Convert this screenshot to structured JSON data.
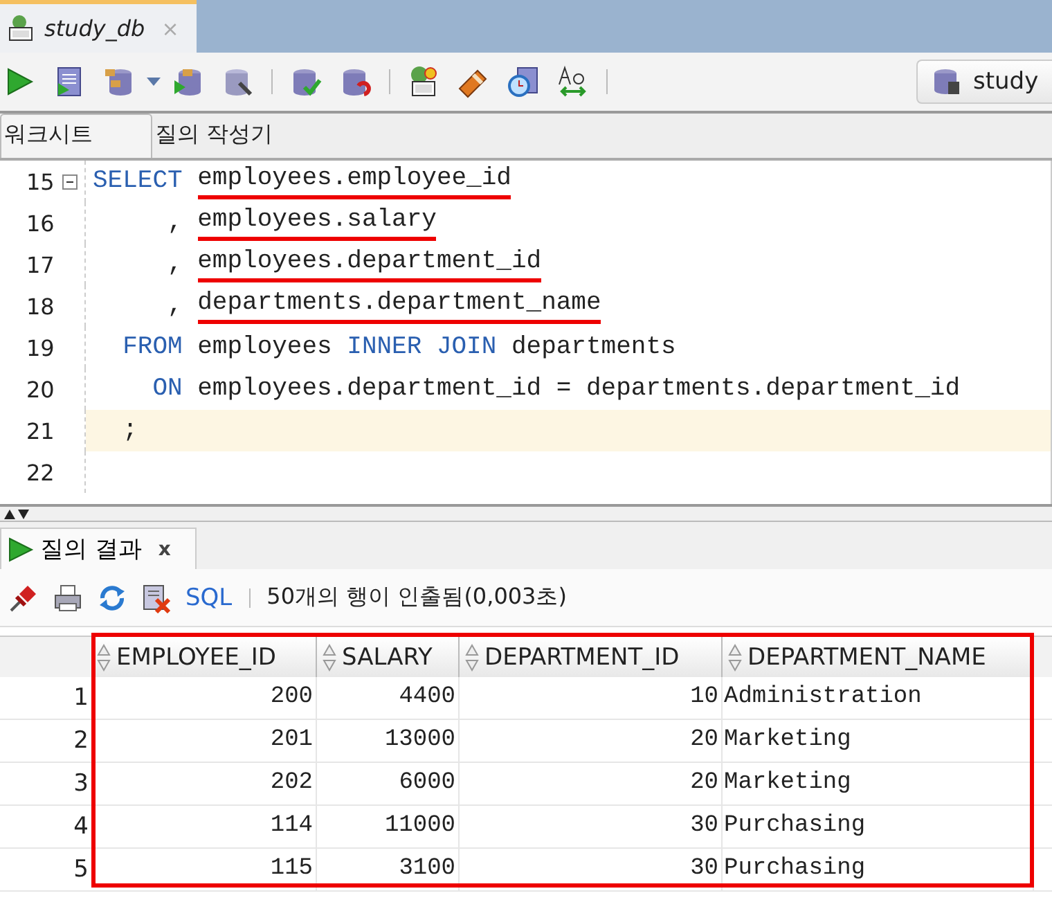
{
  "document_tab": {
    "title": "study_db",
    "close": "×",
    "selected": true
  },
  "connection": {
    "label": "study"
  },
  "editor_tabs": [
    {
      "label": "워크시트",
      "selected": true
    },
    {
      "label": "질의 작성기",
      "selected": false
    }
  ],
  "code_lines": [
    {
      "number": "15",
      "foldable": true,
      "current": false,
      "tokens": [
        {
          "text": "SELECT ",
          "kind": "keyword",
          "underlined": false
        },
        {
          "text": "employees.employee_id",
          "kind": "plain",
          "underlined": true
        }
      ]
    },
    {
      "number": "16",
      "foldable": false,
      "current": false,
      "tokens": [
        {
          "text": "     , ",
          "kind": "plain",
          "underlined": false
        },
        {
          "text": "employees.salary",
          "kind": "plain",
          "underlined": true
        }
      ]
    },
    {
      "number": "17",
      "foldable": false,
      "current": false,
      "tokens": [
        {
          "text": "     , ",
          "kind": "plain",
          "underlined": false
        },
        {
          "text": "employees.department_id",
          "kind": "plain",
          "underlined": true
        }
      ]
    },
    {
      "number": "18",
      "foldable": false,
      "current": false,
      "tokens": [
        {
          "text": "     , ",
          "kind": "plain",
          "underlined": false
        },
        {
          "text": "departments.department_name",
          "kind": "plain",
          "underlined": true
        }
      ]
    },
    {
      "number": "19",
      "foldable": false,
      "current": false,
      "tokens": [
        {
          "text": "  FROM",
          "kind": "keyword",
          "underlined": false
        },
        {
          "text": " employees ",
          "kind": "plain",
          "underlined": false
        },
        {
          "text": "INNER JOIN",
          "kind": "keyword",
          "underlined": false
        },
        {
          "text": " departments",
          "kind": "plain",
          "underlined": false
        }
      ]
    },
    {
      "number": "20",
      "foldable": false,
      "current": false,
      "tokens": [
        {
          "text": "    ON",
          "kind": "keyword",
          "underlined": false
        },
        {
          "text": " employees.department_id = departments.department_id",
          "kind": "plain",
          "underlined": false
        }
      ]
    },
    {
      "number": "21",
      "foldable": false,
      "current": true,
      "tokens": [
        {
          "text": "  ;",
          "kind": "plain",
          "underlined": false
        }
      ]
    },
    {
      "number": "22",
      "foldable": false,
      "current": false
    }
  ],
  "result_tab": {
    "title": "질의 결과",
    "close": "x",
    "selected": true
  },
  "result_toolbar": {
    "sql_link": "SQL",
    "status": "50개의 행이 인출됨(0,003초)"
  },
  "table": {
    "highlighted": true,
    "columns": [
      {
        "label": "EMPLOYEE_ID",
        "kind": "number"
      },
      {
        "label": "SALARY",
        "kind": "number"
      },
      {
        "label": "DEPARTMENT_ID",
        "kind": "number"
      },
      {
        "label": "DEPARTMENT_NAME",
        "kind": "text"
      }
    ],
    "rows": [
      {
        "number": "1",
        "cells": [
          "200",
          "4400",
          "10",
          "Administration"
        ]
      },
      {
        "number": "2",
        "cells": [
          "201",
          "13000",
          "20",
          "Marketing"
        ]
      },
      {
        "number": "3",
        "cells": [
          "202",
          "6000",
          "20",
          "Marketing"
        ]
      },
      {
        "number": "4",
        "cells": [
          "114",
          "11000",
          "30",
          "Purchasing"
        ]
      },
      {
        "number": "5",
        "cells": [
          "115",
          "3100",
          "30",
          "Purchasing"
        ]
      }
    ]
  }
}
